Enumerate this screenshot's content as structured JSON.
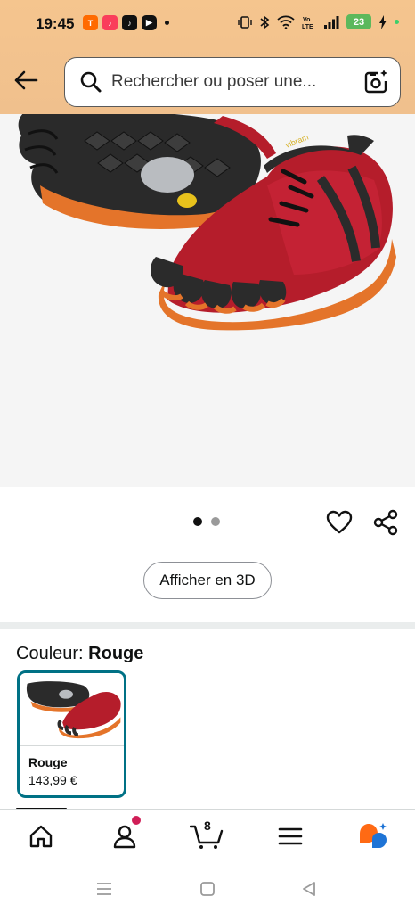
{
  "status_bar": {
    "time": "19:45",
    "battery": "23",
    "app_icons": [
      "temu-icon",
      "music-icon",
      "tiktok-icon",
      "youtube-icon"
    ],
    "system_icons": [
      "vibrate-icon",
      "bluetooth-icon",
      "wifi-icon",
      "volte-icon",
      "signal-icon",
      "battery-icon",
      "charging-icon"
    ]
  },
  "search": {
    "placeholder": "Rechercher ou poser une..."
  },
  "carousel": {
    "dots": 2,
    "active": 0
  },
  "buttons": {
    "view_3d": "Afficher en 3D"
  },
  "color_selector": {
    "label": "Couleur:",
    "selected": "Rouge",
    "options": [
      {
        "name": "Rouge",
        "price": "143,99 €"
      }
    ]
  },
  "bottom_nav": {
    "cart_count": "8",
    "items": [
      "home-icon",
      "account-icon",
      "cart-icon",
      "menu-icon",
      "rufus-icon"
    ]
  },
  "colors": {
    "header_bg": "#f5c58e",
    "accent_teal": "#007185",
    "badge": "#d01e57",
    "shoe_red": "#b51d2b",
    "shoe_orange": "#e4742a"
  }
}
